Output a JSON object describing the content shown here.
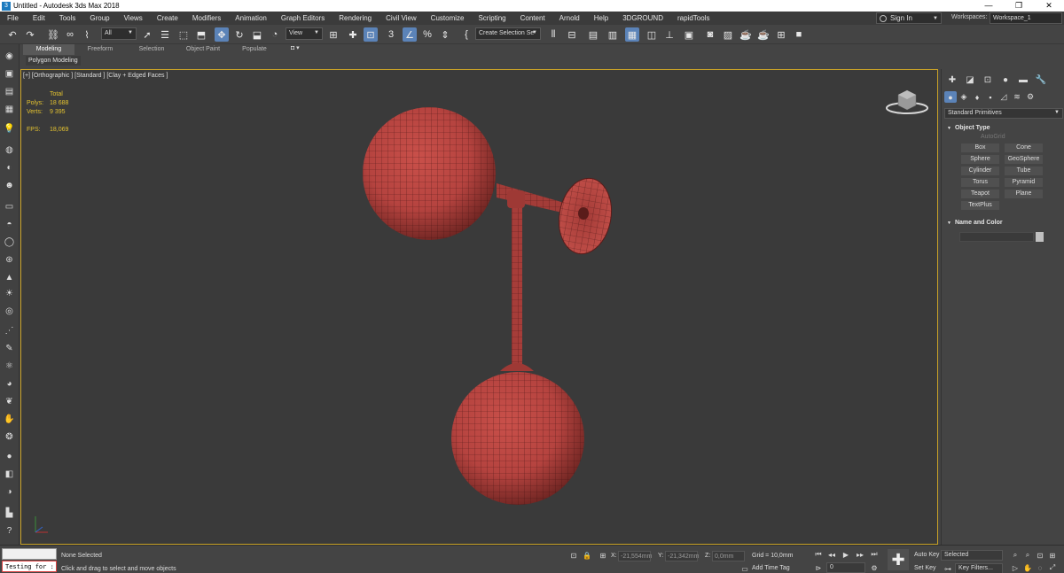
{
  "window": {
    "title": "Untitled - Autodesk 3ds Max 2018",
    "minimize": "—",
    "maximize": "❐",
    "close": "✕"
  },
  "menu": [
    "File",
    "Edit",
    "Tools",
    "Group",
    "Views",
    "Create",
    "Modifiers",
    "Animation",
    "Graph Editors",
    "Rendering",
    "Civil View",
    "Customize",
    "Scripting",
    "Content",
    "Arnold",
    "Help",
    "3DGROUND",
    "rapidTools"
  ],
  "account": {
    "signin_label": "Sign In",
    "workspaces_label": "Workspaces:",
    "workspace_value": "Workspace_1"
  },
  "toolbar": {
    "filter_value": "All",
    "refcoord_value": "View",
    "selection_set_placeholder": "Create Selection Se"
  },
  "ribbon": {
    "tabs": [
      "Modeling",
      "Freeform",
      "Selection",
      "Object Paint",
      "Populate"
    ],
    "active_tab": "Modeling",
    "panel_label": "Polygon Modeling"
  },
  "viewport": {
    "label": "[+] [Orthographic ] [Standard ] [Clay + Edged Faces ]",
    "stats": {
      "header": "Total",
      "polys_label": "Polys:",
      "polys": "18 688",
      "verts_label": "Verts:",
      "verts": "9 395",
      "fps_label": "FPS:",
      "fps": "18,069"
    }
  },
  "command_panel": {
    "dropdown_value": "Standard Primitives",
    "object_type_header": "Object Type",
    "autogrid_label": "AutoGrid",
    "buttons": [
      "Box",
      "Cone",
      "Sphere",
      "GeoSphere",
      "Cylinder",
      "Tube",
      "Torus",
      "Pyramid",
      "Teapot",
      "Plane",
      "TextPlus"
    ],
    "name_color_header": "Name and Color"
  },
  "statusbar": {
    "maxscript_text": "Testing for :",
    "selection_status": "None Selected",
    "prompt": "Click and drag to select and move objects",
    "x_label": "X:",
    "x_value": "-21,554mm",
    "y_label": "Y:",
    "y_value": "-21,342mm",
    "z_label": "Z:",
    "z_value": "0,0mm",
    "grid": "Grid = 10,0mm",
    "add_time_tag": "Add Time Tag",
    "frame": "0",
    "auto_key": "Auto Key",
    "set_key": "Set Key",
    "key_mode_value": "Selected",
    "key_filters": "Key Filters..."
  },
  "colors": {
    "accent": "#5b83b8",
    "viewport_border": "#c9a227",
    "stats_text": "#e3c230",
    "mesh": "#b5433f"
  }
}
